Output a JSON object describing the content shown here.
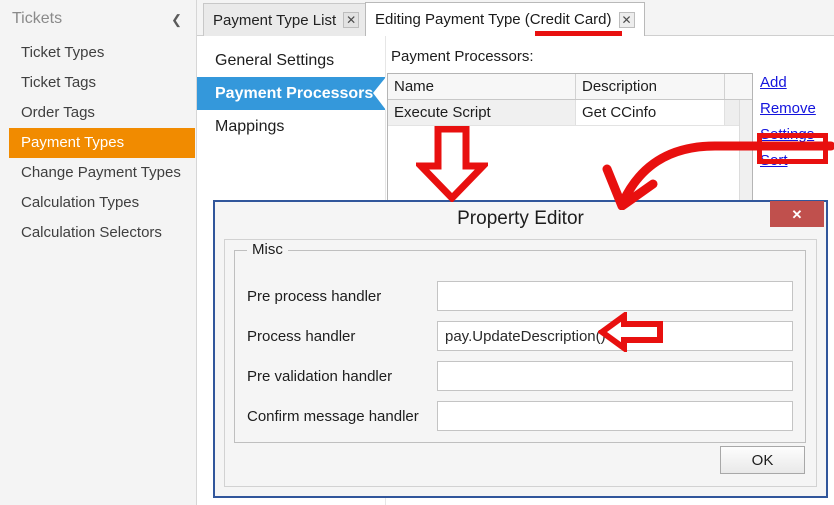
{
  "sidebar": {
    "title": "Tickets",
    "collapse_icon": "chevron-left-icon",
    "items": [
      {
        "label": "Ticket Types",
        "active": false
      },
      {
        "label": "Ticket Tags",
        "active": false
      },
      {
        "label": "Order Tags",
        "active": false
      },
      {
        "label": "Payment Types",
        "active": true
      },
      {
        "label": "Change Payment Types",
        "active": false
      },
      {
        "label": "Calculation Types",
        "active": false
      },
      {
        "label": "Calculation Selectors",
        "active": false
      }
    ]
  },
  "tabs": [
    {
      "label": "Payment Type List",
      "close_icon": "close-icon",
      "active": false
    },
    {
      "label": "Editing Payment Type (Credit Card)",
      "close_icon": "close-icon",
      "active": true
    }
  ],
  "editor": {
    "nav": [
      {
        "label": "General Settings",
        "active": false
      },
      {
        "label": "Payment Processors",
        "active": true
      },
      {
        "label": "Mappings",
        "active": false
      }
    ],
    "content_label": "Payment Processors:",
    "grid": {
      "columns": [
        "Name",
        "Description",
        ""
      ],
      "rows": [
        {
          "name": "Execute Script",
          "description": "Get CCinfo",
          "indicator": "^"
        }
      ],
      "scrollbar": "vertical-scrollbar"
    },
    "links": [
      {
        "label": "Add"
      },
      {
        "label": "Remove"
      },
      {
        "label": "Settings"
      },
      {
        "label": "Sort "
      }
    ]
  },
  "dialog": {
    "title": "Property Editor",
    "close_label": "✕",
    "group_legend": "Misc",
    "fields": [
      {
        "label": "Pre process handler",
        "value": "",
        "placeholder": ""
      },
      {
        "label": "Process handler",
        "value": "pay.UpdateDescription()",
        "placeholder": ""
      },
      {
        "label": "Pre validation handler",
        "value": "",
        "placeholder": ""
      },
      {
        "label": "Confirm message handler",
        "value": "",
        "placeholder": ""
      }
    ],
    "ok_label": "OK"
  },
  "annotations": {
    "color": "#e8100f",
    "items": [
      {
        "name": "underline-credit-card",
        "kind": "underline"
      },
      {
        "name": "highlight-box-settings",
        "kind": "rectangle"
      },
      {
        "name": "arrow-down-to-dialog",
        "kind": "block-arrow-down"
      },
      {
        "name": "curved-arrow-settings-to-dialog",
        "kind": "curved-arrow"
      },
      {
        "name": "arrow-left-to-process-handler",
        "kind": "block-arrow-left"
      }
    ]
  },
  "colors": {
    "sidebar_active": "#f18b00",
    "nav_active": "#3498db",
    "dialog_border": "#31569b",
    "dialog_close": "#c0504d",
    "link": "#1414dd",
    "annotation": "#e8100f"
  }
}
